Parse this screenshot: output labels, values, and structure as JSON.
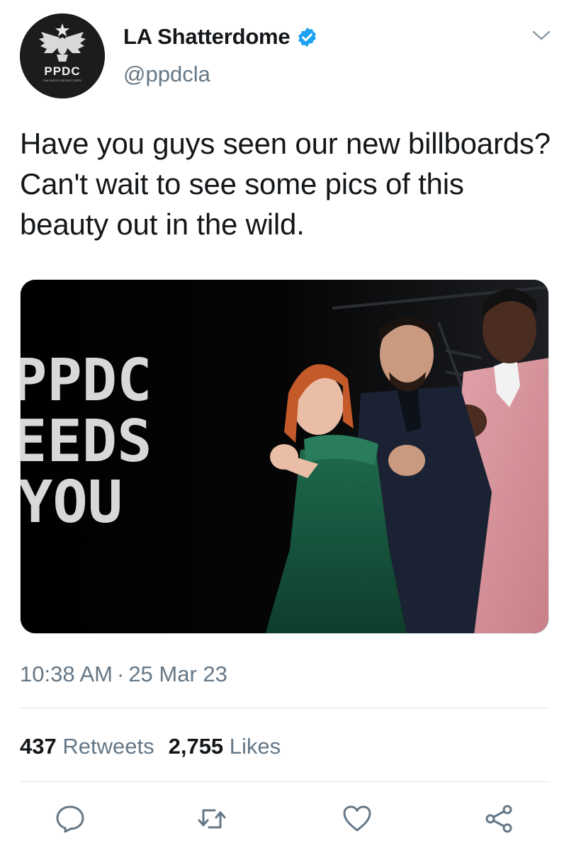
{
  "account": {
    "display_name": "LA Shatterdome",
    "handle": "@ppdcla",
    "avatar_text": "PPDC",
    "avatar_subtext": "PAN PACIFIC DEFENSE CORPS",
    "verified_icon": "verified-badge-icon"
  },
  "tweet": {
    "text": "Have you guys seen our new billboards? Can't wait to see some pics of this beauty out in the wild.",
    "image": {
      "billboard_lines": [
        "PPDC",
        "EEDS",
        "YOU"
      ]
    },
    "time": "10:38 AM",
    "separator": "·",
    "date": "25 Mar 23"
  },
  "stats": {
    "retweets_count": "437",
    "retweets_label": "Retweets",
    "likes_count": "2,755",
    "likes_label": "Likes"
  },
  "actions": [
    "reply-icon",
    "retweet-icon",
    "like-icon",
    "share-icon"
  ],
  "colors": {
    "verified_blue": "#1da1f2",
    "secondary_text": "#657786",
    "primary_text": "#14171a",
    "divider": "#e1e8ed"
  }
}
